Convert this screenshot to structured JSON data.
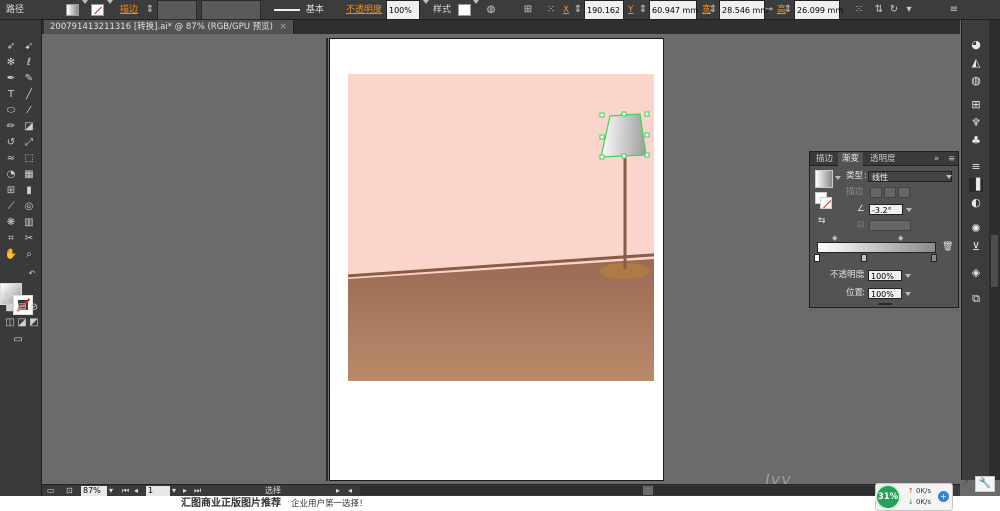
{
  "control_bar": {
    "selection_label": "路径",
    "stroke_label": "描边",
    "brush_label": "基本",
    "opacity_label": "不透明度",
    "opacity_value": "100%",
    "style_label": "样式",
    "x_label": "X",
    "x_value": "190.162",
    "y_label": "Y",
    "y_value": "60.947 mm",
    "w_label": "宽",
    "w_value": "28.546 mm",
    "h_label": "高",
    "h_value": "26.099 mm"
  },
  "document": {
    "tab_title": "200791413211316 [转换].ai* @ 87% (RGB/GPU 预览)",
    "close_glyph": "×"
  },
  "gradient_panel": {
    "tabs": [
      "描边",
      "渐变",
      "透明度"
    ],
    "active_tab": 1,
    "type_label": "类型",
    "type_value": "线性",
    "stroke_label": "描边",
    "angle_value": "-3.2°",
    "opacity_label": "不透明度",
    "opacity_value": "100%",
    "location_label": "位置",
    "location_value": "100%"
  },
  "status_bar": {
    "zoom": "87%",
    "page": "1",
    "mode": "选择"
  },
  "bottom_ad": {
    "headline": "汇图商业正版图片推荐",
    "tagline": "企业用户第一选择！"
  },
  "net_widget": {
    "percent": "31%",
    "upload": "0K/s",
    "download": "0K/s"
  },
  "watermark": "Jyy",
  "colors": {
    "wall": "#fbd5cb",
    "floor_top": "#9a6a54",
    "floor_bottom": "#b98a6a",
    "lamp_stand": "#8a5b45",
    "lamp_base": "#b07a44",
    "selection": "#3ed35a",
    "accent_orange": "#f08a24"
  },
  "icons": {
    "toolbar": [
      "selection-tool-icon",
      "direct-selection-tool-icon",
      "magic-wand-tool-icon",
      "lasso-tool-icon",
      "pen-tool-icon",
      "curvature-tool-icon",
      "type-tool-icon",
      "line-tool-icon",
      "ellipse-tool-icon",
      "paintbrush-tool-icon",
      "pencil-tool-icon",
      "eraser-tool-icon",
      "rotate-tool-icon",
      "scale-tool-icon",
      "warp-tool-icon",
      "free-transform-tool-icon",
      "shape-builder-tool-icon",
      "perspective-tool-icon",
      "mesh-tool-icon",
      "gradient-tool-icon",
      "eyedropper-tool-icon",
      "blend-tool-icon",
      "symbol-sprayer-tool-icon",
      "column-graph-tool-icon",
      "artboard-tool-icon",
      "slice-tool-icon",
      "hand-tool-icon",
      "zoom-tool-icon"
    ],
    "dock": [
      "color-icon",
      "color-guide-icon",
      "swatches-icon",
      "brushes-icon",
      "symbols-icon",
      "graphic-styles-icon",
      "stroke-icon",
      "gradient-icon",
      "transparency-icon",
      "appearance-icon",
      "layers-icon",
      "artboards-icon"
    ]
  }
}
